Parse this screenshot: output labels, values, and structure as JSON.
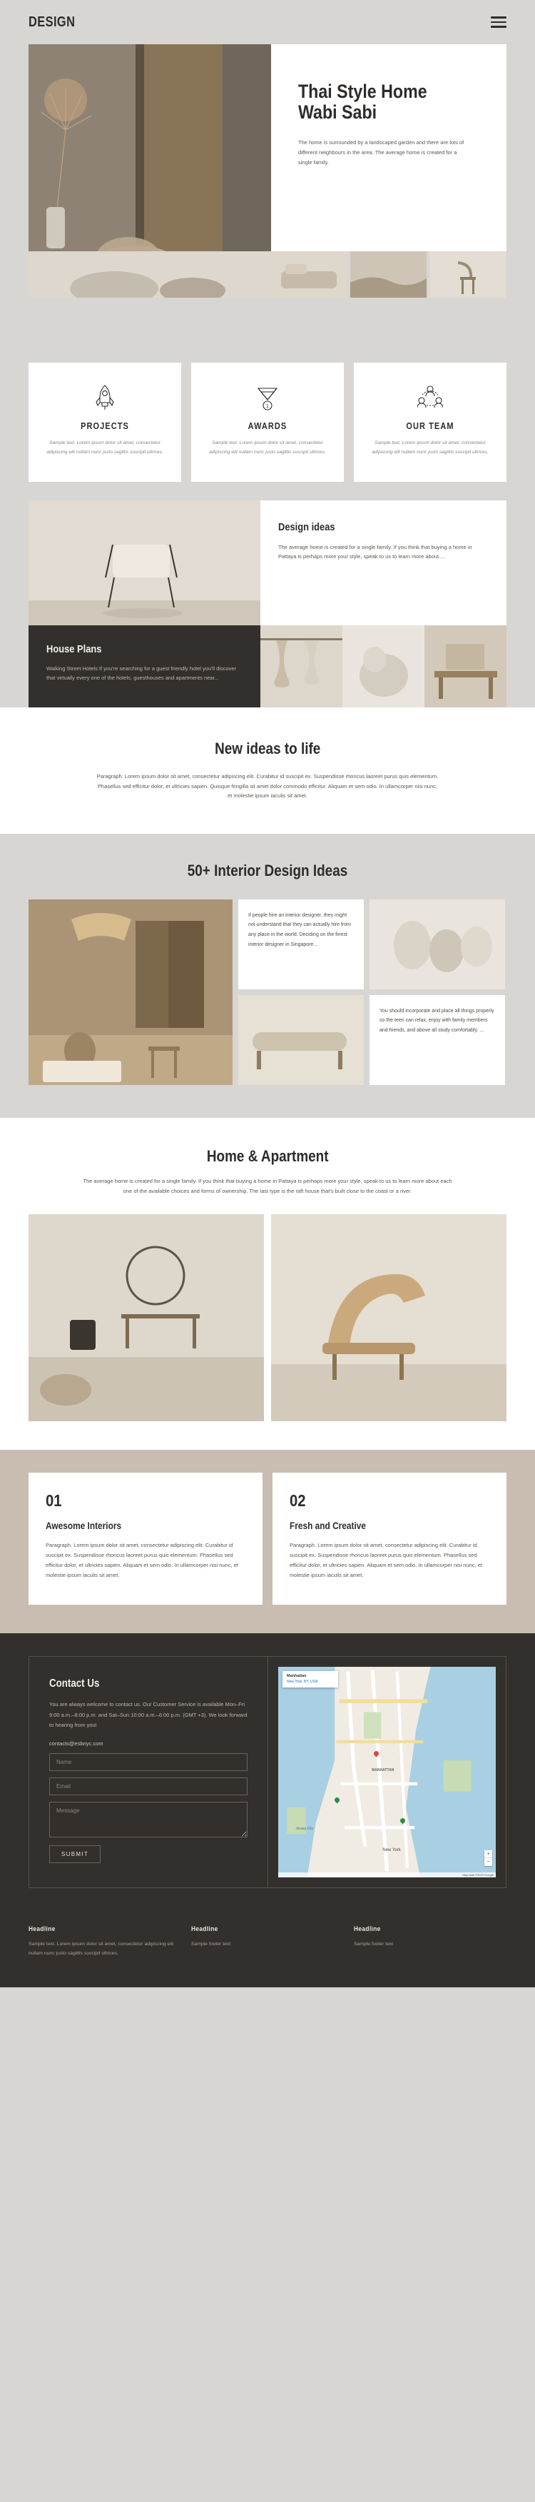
{
  "header": {
    "logo": "DESIGN",
    "menu_icon": "hamburger-icon"
  },
  "hero": {
    "title_line1": "Thai Style Home",
    "title_line2": "Wabi Sabi",
    "paragraph": "The home is surrounded by a landscaped garden and there are lots of different neighbours in the area.  The average home is created for a single family."
  },
  "features": [
    {
      "icon": "rocket-icon",
      "title": "PROJECTS",
      "text": "Sample text. Lorem ipsum dolor sit amet, consectetur adipiscing elit nullam nunc justo sagittis suscipit ultrices."
    },
    {
      "icon": "medal-icon",
      "title": "AWARDS",
      "text": "Sample text. Lorem ipsum dolor sit amet, consectetur adipiscing elit nullam nunc justo sagittis suscipit ultrices."
    },
    {
      "icon": "team-icon",
      "title": "OUR TEAM",
      "text": "Sample text. Lorem ipsum dolor sit amet, consectetur adipiscing elit nullam nunc justo sagittis suscipit ultrices."
    }
  ],
  "ideas": {
    "title": "Design ideas",
    "paragraph": "The average home is created for a single family. If you think that buying a home in Pattaya is perhaps more your style, speak to us to learn more about....",
    "dark_title": "House Plans",
    "dark_paragraph": "Walking Street Hotels If you're searching for a guest friendly hotel you'll discover that virtually every one of the hotels, guesthouses and apartments near..."
  },
  "new_ideas": {
    "title": "New ideas to life",
    "paragraph": "Paragraph. Lorem ipsum dolor sit amet, consectetur adipiscing elit. Curabitur id suscipit ex. Suspendisse rhoncus laoreet purus quis elementum. Phasellus sed efficitur dolor, et ultricies sapien. Quisque fringilla sit amet dolor commodo efficitur. Aliquam et sem odio. In ullamcorper nisi nunc, et molestie ipsum iaculis sit amet."
  },
  "interior": {
    "title": "50+ Interior Design Ideas",
    "text_block_1": "If people hire an interior designer, they might not understand that they can actually hire from any place in the world. Deciding on the finest interior designer in Singapore...",
    "text_block_2": "You should incorporate and place all things properly so the teen can relax, enjoy with family members and friends, and above all study comfortably. ..."
  },
  "home_apartment": {
    "title": "Home & Apartment",
    "paragraph": "The average home is created for a single family. If you think that buying a home in Pattaya is perhaps more your style, speak to us to learn more about each one of the available choices and forms of ownership. The last type is the raft house that's built close to the coast or a river."
  },
  "numbered_cards": [
    {
      "number": "01",
      "title": "Awesome Interiors",
      "text": "Paragraph. Lorem ipsum dolor sit amet, consectetur adipiscing elit. Curabitur id suscipit ex. Suspendisse rhoncus laoreet purus quis elementum. Phasellus sed efficitur dolor, et ultricies sapien. Aliquam et sem odio. In ullamcorper nisi nunc, et molestie ipsum iaculis sit amet."
    },
    {
      "number": "02",
      "title": "Fresh and Creative",
      "text": "Paragraph. Lorem ipsum dolor sit amet, consectetur adipiscing elit. Curabitur id suscipit ex. Suspendisse rhoncus laoreet purus quis elementum. Phasellus sed efficitur dolor, et ultricies sapien. Aliquam et sem odio. In ullamcorper nisi nunc, et molestie ipsum iaculis sit amet."
    }
  ],
  "contact": {
    "title": "Contact Us",
    "paragraph": "You are always welcome to contact us. Our Customer Service is available Mon–Fri 9:00 a.m.–8:00 p.m. and Sat–Sun 10:00 a.m.–6:00 p.m. (GMT +3). We look forward to hearing from you!",
    "email": "contacts@esbnyc.com",
    "name_placeholder": "Name",
    "email_placeholder": "Email",
    "message_placeholder": "Message",
    "submit_label": "SUBMIT"
  },
  "map": {
    "card_title": "Manhattan",
    "card_subtitle": "New York, NY, USA",
    "label_district": "MANHATTAN",
    "label_city": "New York",
    "label_jersey": "Jersey City",
    "zoom_in": "+",
    "zoom_out": "−",
    "attribution": "Map data ©2023 Google"
  },
  "footer": {
    "columns": [
      {
        "headline": "Headline",
        "text": "Sample text. Lorem ipsum dolor sit amet, consectetur adipiscing elit nullam nunc justo sagittis suscipit ultrices."
      },
      {
        "headline": "Headline",
        "text": "Sample footer text"
      },
      {
        "headline": "Headline",
        "text": "Sample footer text"
      }
    ]
  }
}
